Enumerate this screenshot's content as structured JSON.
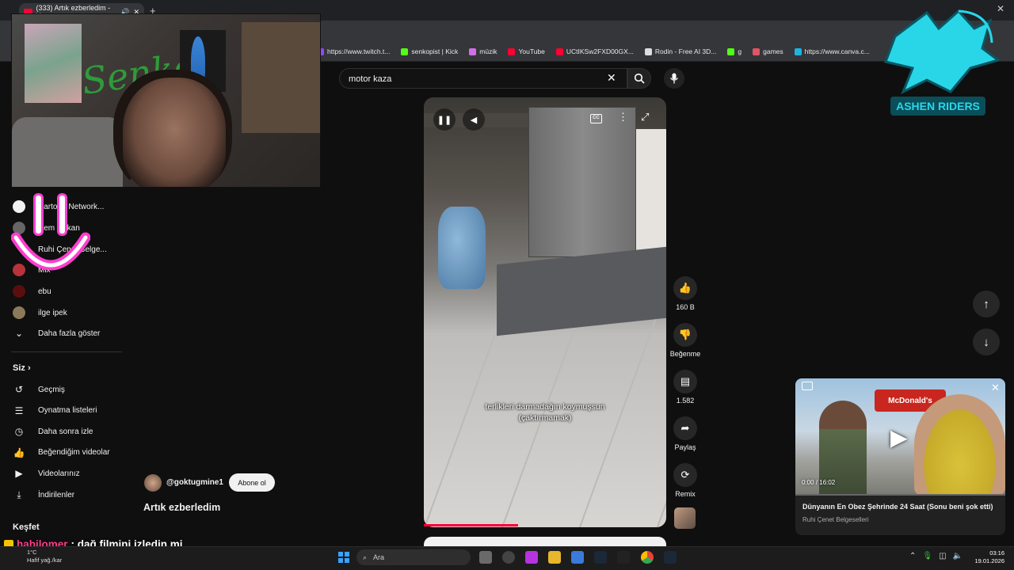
{
  "browser": {
    "active_tab": "(333) Artık ezberledim - Yo",
    "bookmarks": [
      {
        "label": "https://www.twitch.t...",
        "icon": "twitch-icon",
        "color": "#9146ff"
      },
      {
        "label": "senkopist | Kick",
        "icon": "kick-icon",
        "color": "#53fc18"
      },
      {
        "label": "müzik",
        "icon": "folder-icon",
        "color": "#d16fe8"
      },
      {
        "label": "YouTube",
        "icon": "youtube-icon",
        "color": "#ff0033"
      },
      {
        "label": "UCtIKSw2FXD00GX...",
        "icon": "youtube-icon",
        "color": "#ff0033"
      },
      {
        "label": "Rodin - Free AI 3D...",
        "icon": "rodin-icon",
        "color": "#dddddd"
      },
      {
        "label": "g",
        "icon": "kick-icon",
        "color": "#53fc18"
      },
      {
        "label": "games",
        "icon": "games-icon",
        "color": "#e05566"
      },
      {
        "label": "https://www.canva.c...",
        "icon": "canva-icon",
        "color": "#1fb4e0"
      }
    ]
  },
  "search": {
    "query": "motor kaza"
  },
  "sidebar": {
    "subscriptions": [
      {
        "label": "Cartoon Network...",
        "color": "#f1f1f1"
      },
      {
        "label": "Cem Hakan",
        "color": "#666666"
      },
      {
        "label": "Ruhi Çenet Belge...",
        "color": "#0f0f0f"
      },
      {
        "label": "Mix",
        "color": "#b8323c"
      },
      {
        "label": "ebu",
        "color": "#5a0e0e"
      },
      {
        "label": "ilge ipek",
        "color": "#8a7a5a"
      }
    ],
    "show_more": "Daha fazla göster",
    "you_section": "Siz",
    "you_items": [
      {
        "label": "Geçmiş",
        "icon": "history-icon"
      },
      {
        "label": "Oynatma listeleri",
        "icon": "playlist-icon"
      },
      {
        "label": "Daha sonra izle",
        "icon": "clock-icon"
      },
      {
        "label": "Beğendiğim videolar",
        "icon": "thumbs-up-icon"
      },
      {
        "label": "Videolarınız",
        "icon": "video-icon"
      },
      {
        "label": "İndirilenler",
        "icon": "download-icon"
      }
    ],
    "explore": "Keşfet"
  },
  "short": {
    "caption": "terlikleri darmadağın koymuşsun (çaktırmamak)",
    "progress_fraction": 0.39,
    "channel": "@goktugmine1",
    "subscribe": "Abone ol",
    "title": "Artık ezberledim"
  },
  "actions": {
    "likes": "160 B",
    "dislike": "Beğenme",
    "comments": "1.582",
    "share": "Paylaş",
    "remix": "Remix"
  },
  "overlay": {
    "logo_text": "ASHEN RIDERS",
    "chat_user": "habilomer",
    "chat_message": ": dağ filmini izledin mi"
  },
  "mini_player": {
    "sign": "McDonald's",
    "time": "0:00 / 16:02",
    "title": "Dünyanın En Obez Şehrinde 24 Saat (Sonu beni şok etti)",
    "channel": "Ruhi Çenet Belgeselleri"
  },
  "taskbar": {
    "temperature": "1°C",
    "weather": "Hafif yağ./kar",
    "search_placeholder": "Ara",
    "time": "03:16",
    "date": "19.01.2026"
  }
}
